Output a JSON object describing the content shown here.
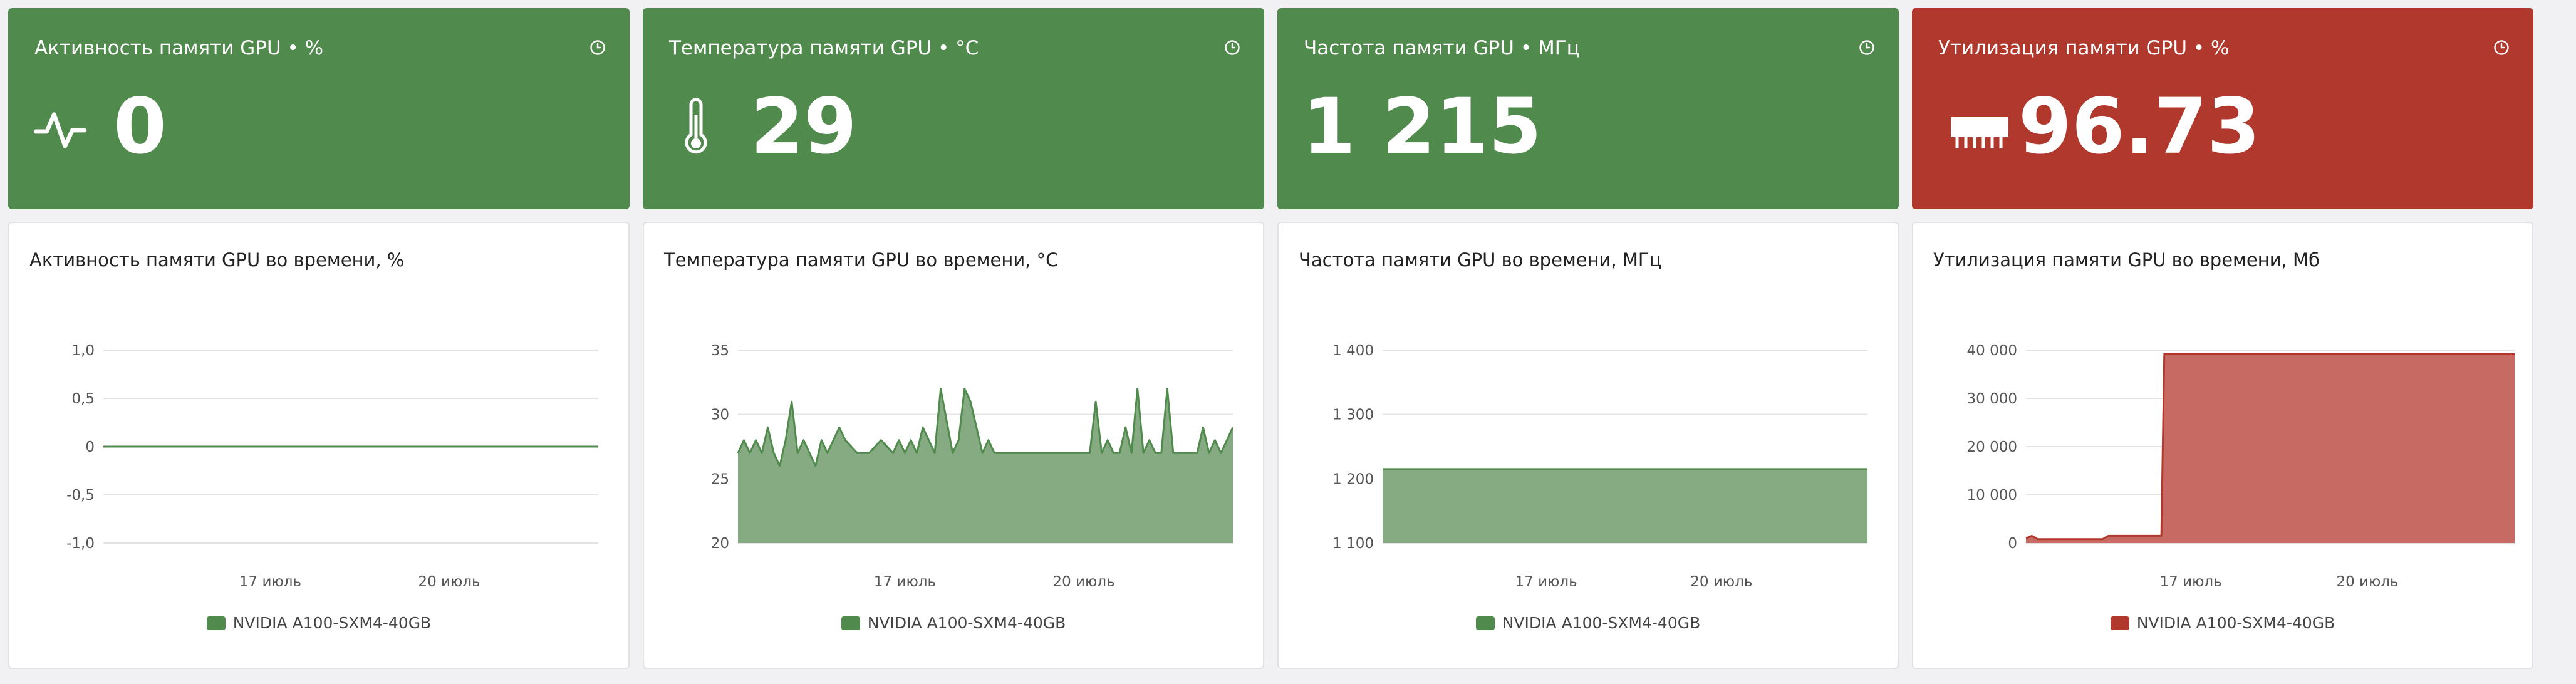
{
  "tiles": [
    {
      "title": "Активность памяти GPU • %",
      "value": "0",
      "color": "#508a4d",
      "icon": "activity-icon"
    },
    {
      "title": "Температура памяти GPU • °C",
      "value": "29",
      "color": "#508a4d",
      "icon": "thermometer-icon"
    },
    {
      "title": "Частота памяти GPU • МГц",
      "value": "1 215",
      "color": "#508a4d",
      "icon": ""
    },
    {
      "title": "Утилизация памяти GPU • %",
      "value": "96.73",
      "color": "#b1382c",
      "icon": "memory-icon"
    }
  ],
  "charts": [
    {
      "title": "Активность памяти GPU во времени, %",
      "legend": "NVIDIA A100-SXM4-40GB",
      "color": "#508a4d",
      "fill": "none"
    },
    {
      "title": "Температура памяти GPU во времени, °C",
      "legend": "NVIDIA A100-SXM4-40GB",
      "color": "#508a4d",
      "fill": "#86ab83"
    },
    {
      "title": "Частота памяти GPU во времени, МГц",
      "legend": "NVIDIA A100-SXM4-40GB",
      "color": "#508a4d",
      "fill": "#86ab83"
    },
    {
      "title": "Утилизация памяти GPU во времени, Мб",
      "legend": "NVIDIA A100-SXM4-40GB",
      "color": "#b1382c",
      "fill": "#c76a63"
    }
  ],
  "chart_data": [
    {
      "type": "line",
      "title": "Активность памяти GPU во времени, %",
      "yticks": [
        "1,0",
        "0,5",
        "0",
        "-0,5",
        "-1,0"
      ],
      "ytick_values": [
        1,
        0.5,
        0,
        -0.5,
        -1
      ],
      "ylim": [
        -1,
        1
      ],
      "xlim": [
        14.2,
        22.5
      ],
      "xticks": [
        {
          "label": "17 июль",
          "value": 17
        },
        {
          "label": "20 июль",
          "value": 20
        }
      ],
      "series": [
        {
          "name": "NVIDIA A100-SXM4-40GB",
          "x": [
            14.2,
            22.5
          ],
          "y": [
            0,
            0
          ]
        }
      ]
    },
    {
      "type": "area",
      "title": "Температура памяти GPU во времени, °C",
      "yticks": [
        "35",
        "30",
        "25",
        "20"
      ],
      "ytick_values": [
        35,
        30,
        25,
        20
      ],
      "ylim": [
        20,
        35
      ],
      "xlim": [
        14.2,
        22.5
      ],
      "xticks": [
        {
          "label": "17 июль",
          "value": 17
        },
        {
          "label": "20 июль",
          "value": 20
        }
      ],
      "series": [
        {
          "name": "NVIDIA A100-SXM4-40GB",
          "x": [
            14.2,
            14.3,
            14.4,
            14.5,
            14.6,
            14.7,
            14.8,
            14.9,
            15.0,
            15.1,
            15.2,
            15.3,
            15.4,
            15.5,
            15.6,
            15.7,
            15.8,
            15.9,
            16.0,
            16.2,
            16.4,
            16.6,
            16.8,
            16.9,
            17.0,
            17.1,
            17.2,
            17.3,
            17.4,
            17.5,
            17.6,
            17.8,
            17.9,
            18.0,
            18.1,
            18.2,
            18.3,
            18.4,
            18.5,
            18.6,
            18.7,
            18.8,
            19.0,
            19.2,
            19.4,
            19.6,
            19.8,
            20.0,
            20.1,
            20.2,
            20.3,
            20.4,
            20.5,
            20.6,
            20.7,
            20.8,
            20.9,
            21.0,
            21.1,
            21.2,
            21.3,
            21.4,
            21.5,
            21.6,
            21.7,
            21.8,
            21.9,
            22.0,
            22.1,
            22.2,
            22.3,
            22.4,
            22.5
          ],
          "y": [
            27,
            28,
            27,
            28,
            27,
            29,
            27,
            26,
            28,
            31,
            27,
            28,
            27,
            26,
            28,
            27,
            28,
            29,
            28,
            27,
            27,
            28,
            27,
            28,
            27,
            28,
            27,
            29,
            28,
            27,
            32,
            27,
            28,
            32,
            31,
            29,
            27,
            28,
            27,
            27,
            27,
            27,
            27,
            27,
            27,
            27,
            27,
            27,
            27,
            31,
            27,
            28,
            27,
            27,
            29,
            27,
            32,
            27,
            28,
            27,
            27,
            32,
            27,
            27,
            27,
            27,
            27,
            29,
            27,
            28,
            27,
            28,
            29
          ]
        }
      ]
    },
    {
      "type": "area",
      "title": "Частота памяти GPU во времени, МГц",
      "yticks": [
        "1 400",
        "1 300",
        "1 200",
        "1 100"
      ],
      "ytick_values": [
        1400,
        1300,
        1200,
        1100
      ],
      "ylim": [
        1100,
        1400
      ],
      "xlim": [
        14.2,
        22.5
      ],
      "xticks": [
        {
          "label": "17 июль",
          "value": 17
        },
        {
          "label": "20 июль",
          "value": 20
        }
      ],
      "series": [
        {
          "name": "NVIDIA A100-SXM4-40GB",
          "x": [
            14.2,
            22.5
          ],
          "y": [
            1215,
            1215
          ]
        }
      ]
    },
    {
      "type": "area",
      "title": "Утилизация памяти GPU во времени, Мб",
      "yticks": [
        "40 000",
        "30 000",
        "20 000",
        "10 000",
        "0"
      ],
      "ytick_values": [
        40000,
        30000,
        20000,
        10000,
        0
      ],
      "ylim": [
        0,
        40000
      ],
      "xlim": [
        14.2,
        22.5
      ],
      "xticks": [
        {
          "label": "17 июль",
          "value": 17
        },
        {
          "label": "20 июль",
          "value": 20
        }
      ],
      "series": [
        {
          "name": "NVIDIA A100-SXM4-40GB",
          "x": [
            14.2,
            14.3,
            14.4,
            14.6,
            15.5,
            15.6,
            16.5,
            16.55,
            22.5
          ],
          "y": [
            1000,
            1500,
            800,
            800,
            800,
            1500,
            1500,
            39200,
            39200
          ]
        }
      ]
    }
  ]
}
